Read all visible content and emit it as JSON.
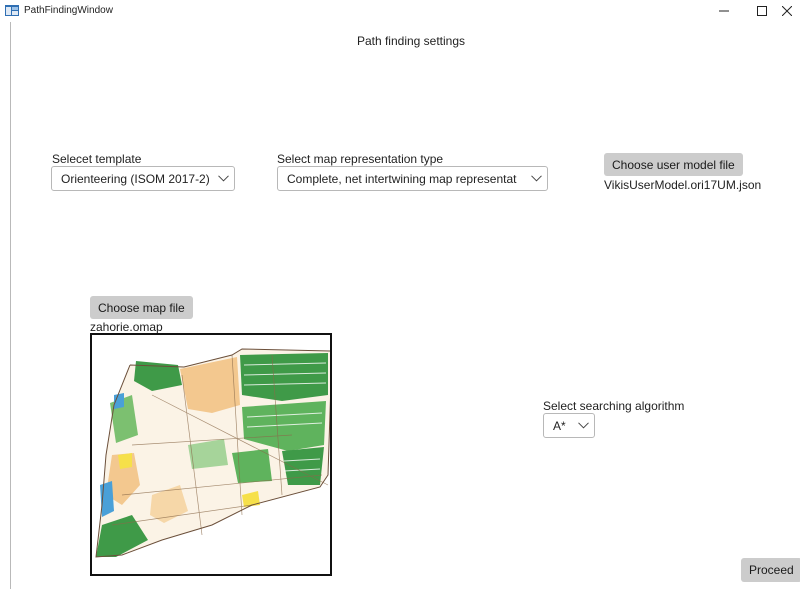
{
  "window": {
    "title": "PathFindingWindow",
    "minimize_glyph": "minimize-icon",
    "maximize_glyph": "maximize-icon",
    "close_glyph": "close-icon"
  },
  "page": {
    "title": "Path finding settings"
  },
  "template": {
    "label": "Selecet template",
    "selected": "Orienteering (ISOM 2017-2)"
  },
  "representation": {
    "label": "Select map representation type",
    "selected": "Complete, net intertwining map representat"
  },
  "user_model": {
    "button_label": "Choose user model file",
    "file_name": "VikisUserModel.ori17UM.json"
  },
  "map": {
    "button_label": "Choose map file",
    "file_name": "zahorie.omap",
    "preview": "orienteering-map-preview"
  },
  "algorithm": {
    "label": "Select searching algorithm",
    "selected": "A*"
  },
  "footer": {
    "proceed_label": "Proceed"
  },
  "colors": {
    "button_bg": "#cccccc",
    "combo_border": "#b8b8b8",
    "map_forest": "#3f9a48",
    "map_open": "#f3c88f",
    "map_water": "#4aa0d8"
  }
}
